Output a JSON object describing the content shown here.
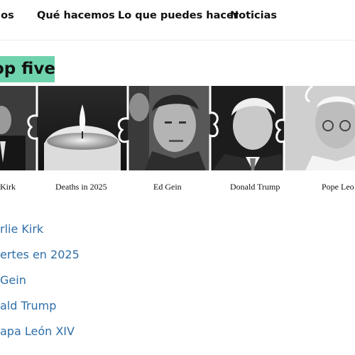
{
  "nav": {
    "items": [
      {
        "label": "mos"
      },
      {
        "label": "Qué hacemos"
      },
      {
        "label": "Lo que puedes hacer"
      },
      {
        "label": "Noticias"
      }
    ]
  },
  "section": {
    "title": "op five"
  },
  "puzzle": {
    "captions": [
      "Kirk",
      "Deaths in 2025",
      "Ed Gein",
      "Donald Trump",
      "Pope Leo"
    ]
  },
  "links": [
    "rlie Kirk",
    "ertes en 2025",
    "Gein",
    "ald Trump",
    "apa León XIV"
  ]
}
